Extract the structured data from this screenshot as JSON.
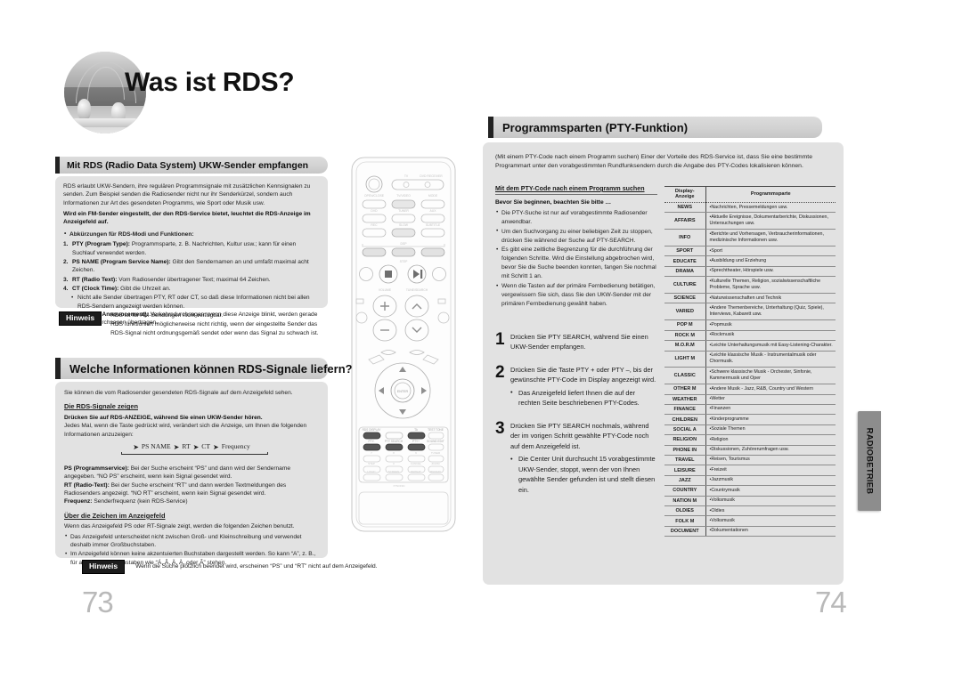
{
  "document": {
    "left_page_number": "73",
    "right_page_number": "74",
    "side_tab_label": "RADIOBETRIEB"
  },
  "title": {
    "heading": "Was ist RDS?",
    "photo_alt": "rds-photo"
  },
  "left_page": {
    "section1": {
      "heading": "Mit RDS (Radio Data System) UKW-Sender empfangen",
      "intro": "RDS erlaubt UKW-Sendern, ihre regulären Programmsignale mit zusätzlichen Kennsignalen zu senden. Zum Beispiel senden die Radiosender nicht nur ihr Senderkürzel, sondern auch Informationen zur Art des gesendeten Programms, wie Sport oder Musik usw.",
      "bold_note": "Wird ein FM-Sender eingestellt, der den RDS-Service bietet, leuchtet die RDS-Anzeige im Anzeigefeld auf.",
      "abbrev_header": "Abkürzungen für RDS-Modi und Funktionen:",
      "items": [
        {
          "num": "1.",
          "term": "PTY (Program Type):",
          "text": "Programmsparte, z. B. Nachrichten, Kultur usw.; kann für einen Suchlauf verwendet werden."
        },
        {
          "num": "2.",
          "term": "PS NAME (Program Service Name):",
          "text": "Gibt den Sendernamen an und umfaßt maximal acht Zeichen."
        },
        {
          "num": "3.",
          "term": "RT (Radio Text):",
          "text": "Vom Radiosender übertragener Text; maximal 64 Zeichen."
        },
        {
          "num": "4.",
          "term": "CT (Clock Time):",
          "text": "Gibt die Uhrzeit an."
        }
      ],
      "sub_bullet": "Nicht alle Sender übertragen PTY, RT oder CT, so daß diese Informationen nicht bei allen RDS-Sendern angezeigt werden können.",
      "item5": {
        "num": "5.",
        "term": "TA (Traffic Announcement):",
        "text": "Verkehrsdurchsagen; wenn diese Anzeige blinkt, werden gerade Verkehrsdurchsagen übertragen."
      },
      "note_label": "Hinweis",
      "notes": [
        "RDS ist für AM-Sendungen nicht  verfügbar.",
        "RDS funktioniert möglicherweise nicht richtig, wenn der eingestellte Sender das RDS-Signal nicht ordnungsgemäß sendet oder wenn das Signal zu schwach ist."
      ]
    },
    "section2": {
      "heading": "Welche Informationen können RDS-Signale liefern?",
      "intro": "Sie können die vom Radiosender gesendeten RDS-Signale auf dem Anzeigefeld sehen.",
      "sub_heading_1": "Die RDS-Signale zeigen",
      "bold_line": "Drücken Sie auf RDS-ANZEIGE, während Sie einen UKW-Sender hören.",
      "para": "Jedes Mal, wenn die Taste gedrückt wird, verändert sich die Anzeige, um Ihnen die folgenden Informationen anzuzeigen:",
      "flow": [
        "PS NAME",
        "RT",
        "CT",
        "Frequency"
      ],
      "defs": [
        {
          "term": "PS (Programmservice):",
          "text": "Bei der Suche erscheint “PS” und dann wird der Sendername angegeben. “NO PS” erscheint, wenn kein Signal gesendet wird."
        },
        {
          "term": "RT (Radio-Text):",
          "text": "Bei der Suche erscheint “RT” und dann werden Textmeldungen des Radiosenders angezeigt. “NO RT” erscheint, wenn kein Signal gesendet wird."
        },
        {
          "term": "Frequenz:",
          "text": "Senderfrequenz (kein RDS-Service)"
        }
      ],
      "sub_heading_2": "Über die Zeichen im Anzeigefeld",
      "chars_intro": "Wenn das Anzeigefeld PS oder RT-Signale zeigt, werden die folgenden Zeichen benutzt.",
      "chars_bullets": [
        "Das Anzeigefeld unterscheidet nicht zwischen Groß- und Kleinschreibung und verwendet deshalb immer Großbuchstaben.",
        "Im Anzeigefeld können keine akzentuierten Buchstaben dargestellt werden. So kann “A”, z. B., für akzentuierte Buchstaben wie “Á, Â, Ä, À, oder Ã” stehen."
      ],
      "note_label": "Hinweis",
      "note": "Wenn die Suche plötzlich beendet wird, erscheinen “PS” und “RT” nicht auf dem Anzeigefeld."
    }
  },
  "right_page": {
    "heading": "Programmsparten (PTY-Funktion)",
    "intro": "(Mit einem PTY-Code nach einem Programm suchen) Einer der Vorteile des RDS-Service ist, dass Sie eine bestimmte Programmart unter den vorabgestimmten Rundfunksendern durch die Angabe des PTY-Codes lokalisieren können.",
    "sub_heading": "Mit dem PTY-Code nach einem Programm suchen",
    "before_heading": "Bevor Sie beginnen, beachten Sie bitte …",
    "before_bullets": [
      "Die PTY-Suche ist nur auf vorabgestimmte Radiosender anwendbar.",
      "Um den Suchvorgang zu einer beliebigen Zeit zu stoppen, drücken Sie während der Suche auf PTY-SEARCH.",
      "Es gibt eine zeitliche Begrenzung für die durchführung der folgenden Schritte. Wird die Einstellung abgebrochen wird, bevor Sie die Suche beenden konnten, fangen Sie nochmal mit Schritt 1 an.",
      "Wenn die Tasten auf der primäre Fernbedienung betätigen, vergewissern Sie sich, dass Sie den UKW-Sender mit der primären Fernbedienung gewählt haben."
    ],
    "steps": [
      {
        "num": "1",
        "text": "Drücken Sie PTY SEARCH, während Sie einen UKW-Sender empfangen.",
        "sub": ""
      },
      {
        "num": "2",
        "text": "Drücken Sie die Taste PTY + oder PTY –, bis der gewünschte PTY-Code im Display angezeigt wird.",
        "sub": "Das Anzeigefeld liefert Ihnen die auf der rechten Seite beschriebenen PTY-Codes."
      },
      {
        "num": "3",
        "text": "Drücken Sie PTY SEARCH nochmals, während der im vorigen Schritt gewählte PTY-Code noch auf dem Anzeigefeld ist.",
        "sub": "Die Center Unit durchsucht 15 vorabgestimmte UKW-Sender, stoppt, wenn der von Ihnen gewählte Sender gefunden ist und stellt diesen ein."
      }
    ],
    "table": {
      "headers": [
        "Display-Anzeige",
        "Programmsparte"
      ],
      "rows": [
        {
          "code": "NEWS",
          "desc": "Nachrichten, Pressemeldungen usw."
        },
        {
          "code": "AFFAIRS",
          "desc": "Aktuelle Ereignisse, Dokumentarberichte, Diskussionen, Untersuchungen usw."
        },
        {
          "code": "INFO",
          "desc": "Berichte und Vorhersagen, Verbraucherinformationen, medizinische Informationen usw."
        },
        {
          "code": "SPORT",
          "desc": "Sport"
        },
        {
          "code": "EDUCATE",
          "desc": "Ausbildung und Erziehung"
        },
        {
          "code": "DRAMA",
          "desc": "Sprechtheater, Hörspiele usw."
        },
        {
          "code": "CULTURE",
          "desc": "Kulturelle Themen, Religion, sozialwissenschaftliche Probleme, Sprache usw."
        },
        {
          "code": "SCIENCE",
          "desc": "Naturwissenschaften und Technik"
        },
        {
          "code": "VARIED",
          "desc": "Andere Themenbereiche, Unterhaltung (Quiz, Spiele), Interviews, Kabarett usw."
        },
        {
          "code": "POP M",
          "desc": "Popmusik"
        },
        {
          "code": "ROCK M",
          "desc": "Rockmusik"
        },
        {
          "code": "M.O.R.M",
          "desc": "Leichte Unterhaltungsmusik mit Easy-Listening-Charakter."
        },
        {
          "code": "LIGHT M",
          "desc": "Leichte klassische Musik -  Instrumentalmusik oder Chormusik."
        },
        {
          "code": "CLASSIC",
          "desc": "Schwere klassische Musik - Orchester, Sinfonie, Kammermusik und Oper"
        },
        {
          "code": "OTHER M",
          "desc": "Andere Musik - Jazz, R&B, Country und Western"
        },
        {
          "code": "WEATHER",
          "desc": "Wetter"
        },
        {
          "code": "FINANCE",
          "desc": "Finanzen"
        },
        {
          "code": "CHILDREN",
          "desc": "Kinderprogramme"
        },
        {
          "code": "SOCIAL A",
          "desc": "Soziale Themen"
        },
        {
          "code": "RELIGION",
          "desc": "Religion"
        },
        {
          "code": "PHONE IN",
          "desc": "Diskussionen, Zuhörerumfragen usw."
        },
        {
          "code": "TRAVEL",
          "desc": "Reisen, Tourismus"
        },
        {
          "code": "LEISURE",
          "desc": "Freizeit"
        },
        {
          "code": "JAZZ",
          "desc": "Jazzmusik"
        },
        {
          "code": "COUNTRY",
          "desc": "Countrymusik"
        },
        {
          "code": "NATION M",
          "desc": "Volksmusik"
        },
        {
          "code": "OLDIES",
          "desc": "Oldies"
        },
        {
          "code": "FOLK M",
          "desc": "Volksmusik"
        },
        {
          "code": "DOCUMENT",
          "desc": "Dokumentationen"
        }
      ]
    }
  },
  "remote": {
    "name": "remote-control-illustration",
    "labels": {
      "tv": "TV",
      "dvd_receiver": "DVD RECEIVER",
      "open_close": "OPEN/CLOSE",
      "tuning": "TV/VIDEO",
      "mode": "MODE",
      "dvd": "DVD",
      "tuner": "TUNER",
      "aux": "AUX",
      "rec": "REC",
      "slow": "SLOW",
      "subtitle": "SUBTITLE",
      "dsp": "DSP",
      "surround": "SURR.",
      "music": "MUSIC",
      "movie": "MOVIE",
      "step": "STEP",
      "volume": "VOLUME",
      "tune_search": "TUNE/SEARCH",
      "file_mode": "FILE MODE",
      "file_effect": "FILE EFFECT",
      "enter": "ENTER",
      "rds_display": "RDS DISPLAY",
      "ta": "TA",
      "pty_minus": "PTY-",
      "pty_search": "PTY SEARCH",
      "pty_plus": "PTY+",
      "test_tone": "TEST TONE",
      "sound_edit": "SOUND EDIT",
      "tuner_memory": "TUNER MEMORY",
      "zoom": "ZOOM",
      "cancel": "CANCEL",
      "logo": "SAMSUNG"
    }
  }
}
